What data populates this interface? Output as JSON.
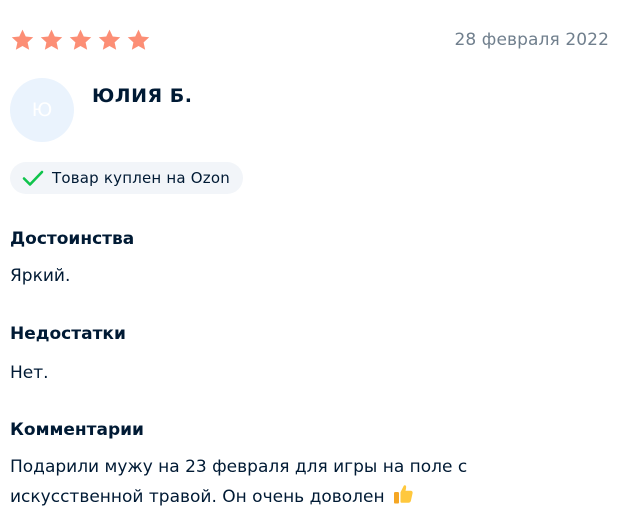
{
  "review": {
    "rating": 5,
    "rating_max": 5,
    "star_color": "#fc8e75",
    "date": "28 февраля 2022",
    "author": {
      "initial": "Ю",
      "name": "ЮЛИЯ Б."
    },
    "badge": {
      "label": "Товар куплен на Ozon",
      "icon": "checkmark-icon",
      "icon_color": "#10c44c"
    },
    "sections": {
      "pros": {
        "title": "Достоинства",
        "text": "Яркий."
      },
      "cons": {
        "title": "Недостатки",
        "text": "Нет."
      },
      "comment": {
        "title": "Комментарии",
        "text": "Подарили мужу на 23 февраля для игры на поле с искусственной травой. Он очень доволен",
        "emoji": "thumbs-up-icon"
      }
    }
  }
}
